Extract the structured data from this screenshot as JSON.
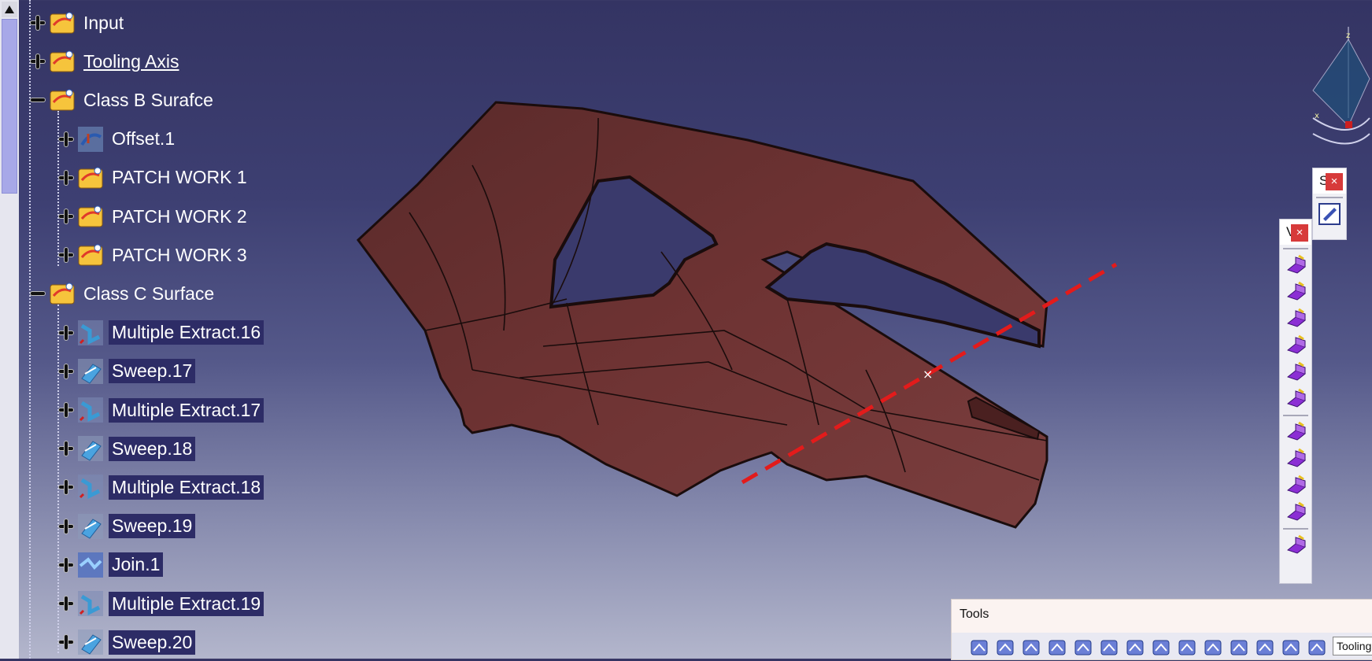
{
  "tree": {
    "items": [
      {
        "label": "Input",
        "expand": "+",
        "icon": "geometrical-set-icon",
        "level": 0
      },
      {
        "label": "Tooling Axis",
        "expand": "+",
        "icon": "geometrical-set-icon",
        "level": 0,
        "underlined": true
      },
      {
        "label": "Class B Surafce",
        "expand": "-",
        "icon": "geometrical-set-icon",
        "level": 0
      },
      {
        "label": "Offset.1",
        "expand": "+",
        "icon": "offset-icon",
        "level": 1
      },
      {
        "label": "PATCH WORK 1",
        "expand": "+",
        "icon": "geometrical-set-icon",
        "level": 1
      },
      {
        "label": "PATCH WORK 2",
        "expand": "+",
        "icon": "geometrical-set-icon",
        "level": 1
      },
      {
        "label": "PATCH WORK 3",
        "expand": "+",
        "icon": "geometrical-set-icon",
        "level": 1
      },
      {
        "label": "Class C Surface",
        "expand": "-",
        "icon": "geometrical-set-icon",
        "level": 0
      },
      {
        "label": "Multiple Extract.16",
        "expand": "+",
        "icon": "extract-icon",
        "level": 1,
        "highlighted": true
      },
      {
        "label": "Sweep.17",
        "expand": "+",
        "icon": "sweep-icon",
        "level": 1,
        "highlighted": true
      },
      {
        "label": "Multiple Extract.17",
        "expand": "+",
        "icon": "extract-icon",
        "level": 1,
        "highlighted": true
      },
      {
        "label": "Sweep.18",
        "expand": "+",
        "icon": "sweep-icon",
        "level": 1,
        "highlighted": true
      },
      {
        "label": "Multiple Extract.18",
        "expand": "+",
        "icon": "extract-icon",
        "level": 1,
        "highlighted": true
      },
      {
        "label": "Sweep.19",
        "expand": "+",
        "icon": "sweep-icon",
        "level": 1,
        "highlighted": true
      },
      {
        "label": "Join.1",
        "expand": "+",
        "icon": "join-icon",
        "level": 1,
        "highlighted": true
      },
      {
        "label": "Multiple Extract.19",
        "expand": "+",
        "icon": "extract-icon",
        "level": 1,
        "highlighted": true
      },
      {
        "label": "Sweep.20",
        "expand": "+",
        "icon": "sweep-icon",
        "level": 1,
        "highlighted": true
      }
    ]
  },
  "compass": {
    "x_label": "x",
    "z_label": "z"
  },
  "toolbar_s": {
    "title": "S",
    "close": "×"
  },
  "toolbar_v": {
    "title": "V",
    "close": "×"
  },
  "tools_toolbar": {
    "title": "Tools",
    "badge": "Tooling"
  },
  "colors": {
    "part": "#6f3434",
    "axis_line": "#e31b1b",
    "highlight": "#2d2c66"
  }
}
